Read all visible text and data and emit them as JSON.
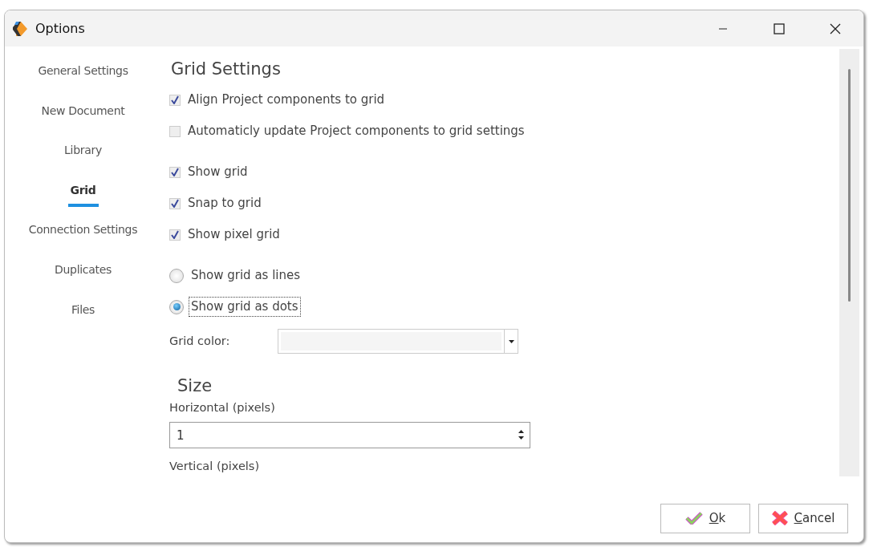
{
  "window": {
    "title": "Options"
  },
  "sidebar": {
    "items": [
      {
        "label": "General Settings",
        "selected": false
      },
      {
        "label": "New Document",
        "selected": false
      },
      {
        "label": "Library",
        "selected": false
      },
      {
        "label": "Grid",
        "selected": true
      },
      {
        "label": "Connection Settings",
        "selected": false
      },
      {
        "label": "Duplicates",
        "selected": false
      },
      {
        "label": "Files",
        "selected": false
      }
    ]
  },
  "content": {
    "heading": "Grid Settings",
    "checkbox_groups": [
      [
        {
          "label": "Align Project components to grid",
          "checked": true
        },
        {
          "label": "Automaticly update Project components to grid settings",
          "checked": false
        }
      ],
      [
        {
          "label": "Show grid",
          "checked": true
        },
        {
          "label": "Snap to grid",
          "checked": true
        },
        {
          "label": "Show pixel grid",
          "checked": true
        }
      ]
    ],
    "radios": [
      {
        "label": "Show grid as lines",
        "selected": false,
        "focused": false
      },
      {
        "label": "Show grid as dots",
        "selected": true,
        "focused": true
      }
    ],
    "grid_color": {
      "label": "Grid color:"
    },
    "size": {
      "heading": "Size",
      "horizontal": {
        "label": "Horizontal (pixels)",
        "value": "1"
      },
      "vertical": {
        "label": "Vertical (pixels)"
      }
    }
  },
  "buttons": [
    {
      "label": "Ok",
      "kind": "ok"
    },
    {
      "label": "Cancel",
      "kind": "cancel"
    }
  ]
}
